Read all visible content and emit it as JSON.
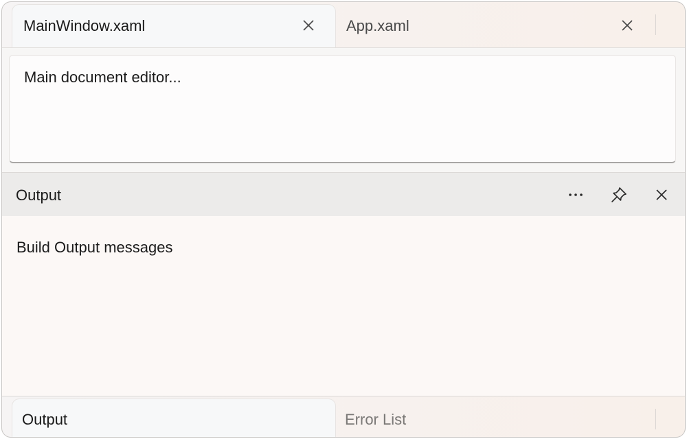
{
  "document_tabs": [
    {
      "label": "MainWindow.xaml",
      "active": true,
      "close_icon": "close-icon"
    },
    {
      "label": "App.xaml",
      "active": false,
      "close_icon": "close-icon"
    }
  ],
  "document": {
    "content": "Main document editor..."
  },
  "tool_pane": {
    "title": "Output",
    "actions": [
      {
        "name": "more-options",
        "icon": "ellipsis-icon"
      },
      {
        "name": "pin",
        "icon": "pin-icon"
      },
      {
        "name": "close",
        "icon": "close-icon"
      }
    ],
    "content": "Build Output messages"
  },
  "bottom_tabs": [
    {
      "label": "Output",
      "active": true
    },
    {
      "label": "Error List",
      "active": false
    }
  ],
  "colors": {
    "window_border": "#c8c6c4",
    "active_tab": "#f7f8f9",
    "pane_header": "#ecebea",
    "pane_body": "#fcf8f6",
    "text": "#1b1b1b",
    "muted_text": "#7a7876"
  }
}
